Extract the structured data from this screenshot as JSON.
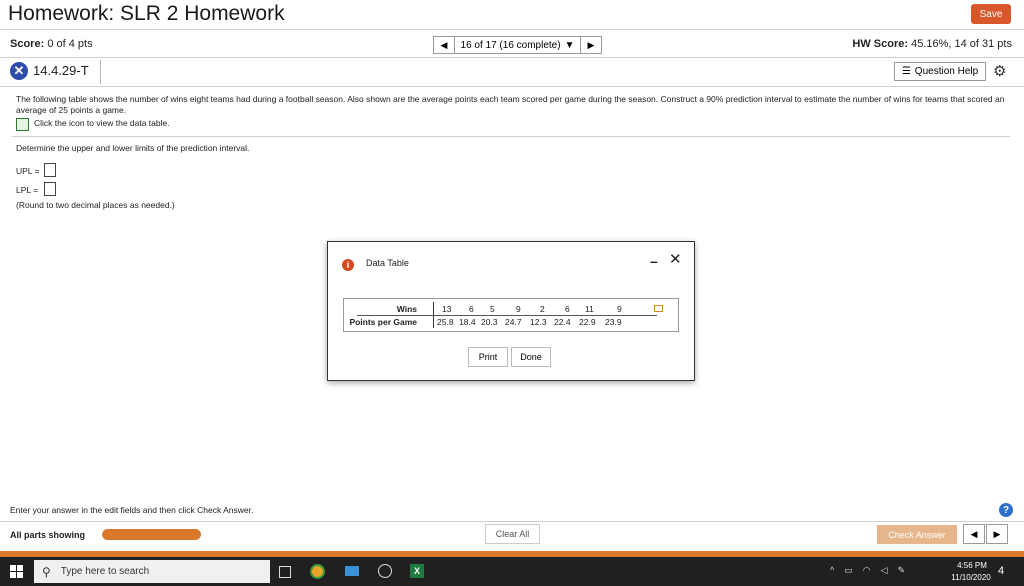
{
  "header": {
    "title": "Homework: SLR 2 Homework",
    "save_label": "Save",
    "score_label": "Score:",
    "score_value": "0 of 4 pts",
    "nav_text": "16 of 17 (16 complete)",
    "hw_score_label": "HW Score:",
    "hw_score_value": "45.16%, 14 of 31 pts"
  },
  "question": {
    "id": "14.4.29-T",
    "help_label": "Question Help",
    "prompt": "The following table shows the number of wins eight teams had during a football season. Also shown are the average points each team scored per game during the season. Construct a 90% prediction interval to estimate the number of wins for teams that scored an average of 25 points a game.",
    "table_link": "Click the icon to view the data table.",
    "determine": "Determine the upper and lower limits of the prediction interval.",
    "upl_label": "UPL =",
    "lpl_label": "LPL =",
    "rounding": "(Round to two decimal places as needed.)"
  },
  "modal": {
    "title": "Data Table",
    "row1_label": "Wins",
    "row2_label": "Points per Game",
    "wins": [
      "13",
      "6",
      "5",
      "9",
      "2",
      "6",
      "11",
      "9"
    ],
    "points": [
      "25.8",
      "18.4",
      "20.3",
      "24.7",
      "12.3",
      "22.4",
      "22.9",
      "23.9"
    ],
    "print_label": "Print",
    "done_label": "Done"
  },
  "footer": {
    "enter_text": "Enter your answer in the edit fields and then click Check Answer.",
    "all_parts": "All parts showing",
    "progress_fraction": 1.0,
    "clear_label": "Clear All",
    "check_label": "Check Answer"
  },
  "taskbar": {
    "search_placeholder": "Type here to search",
    "time": "4:56 PM",
    "date": "11/10/2020",
    "notif_count": "4"
  },
  "colors": {
    "accent": "#d9582b",
    "progress": "#d9782b",
    "info_blue": "#2f4da8"
  }
}
